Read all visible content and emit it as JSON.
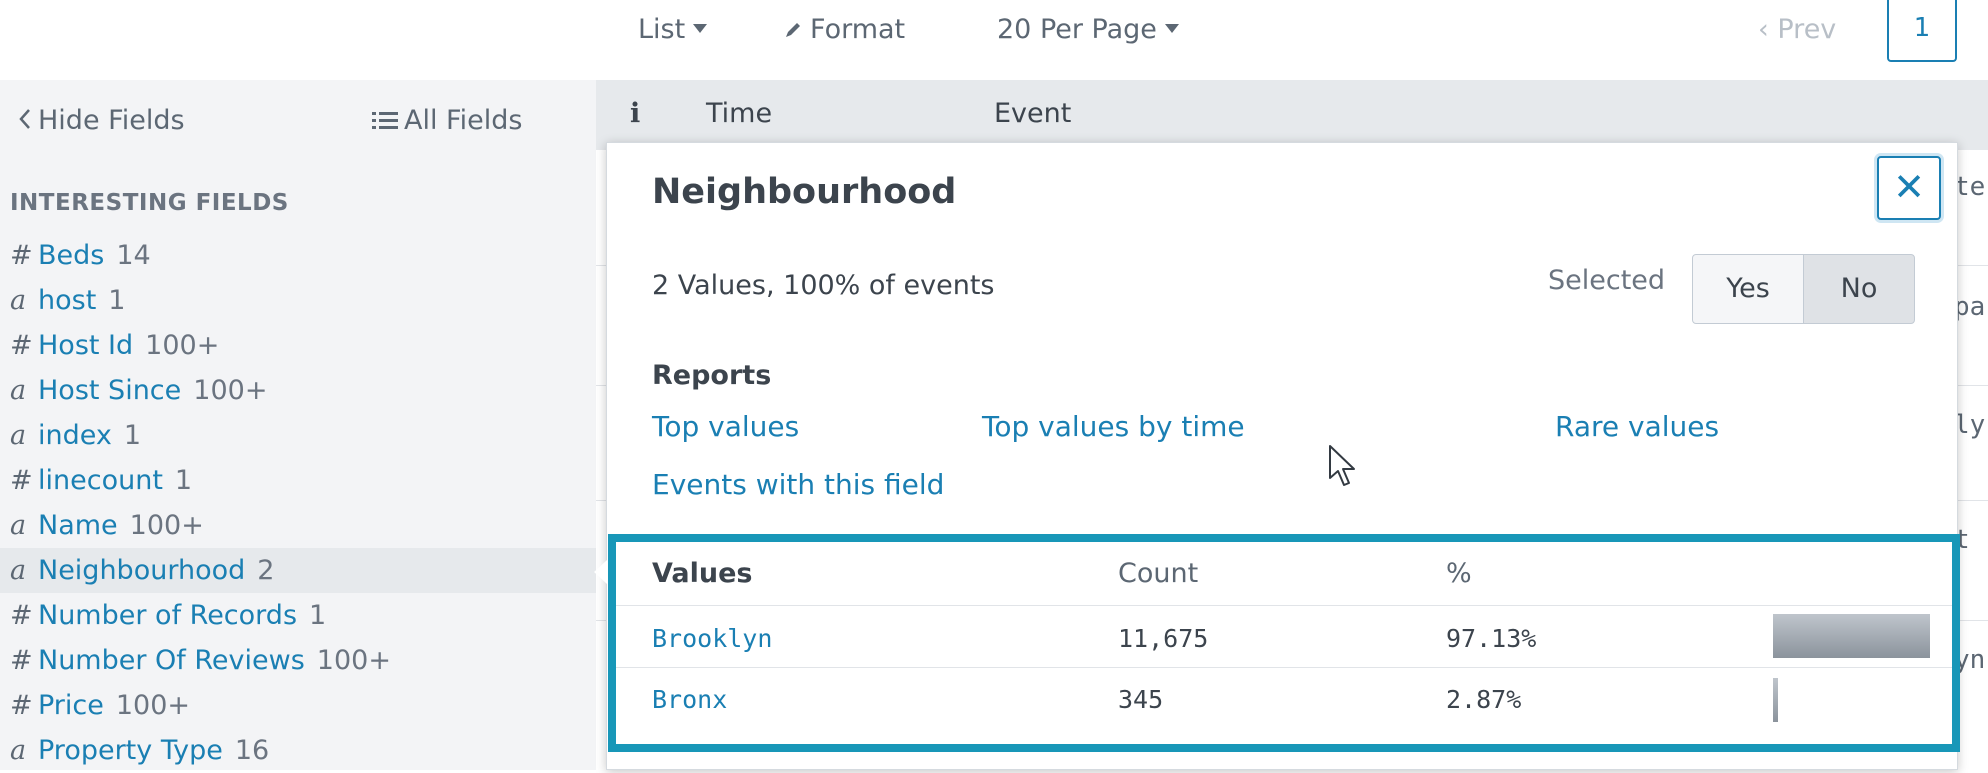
{
  "toolbar": {
    "list_label": "List",
    "format_label": "Format",
    "per_page_label": "20 Per Page",
    "prev_label": "‹ Prev",
    "page_number": "1"
  },
  "sidebar": {
    "hide_fields_label": "Hide Fields",
    "all_fields_label": "All Fields",
    "section_title": "INTERESTING FIELDS",
    "fields": [
      {
        "type": "#",
        "name": "Beds",
        "count": "14"
      },
      {
        "type": "a",
        "name": "host",
        "count": "1"
      },
      {
        "type": "#",
        "name": "Host Id",
        "count": "100+"
      },
      {
        "type": "a",
        "name": "Host Since",
        "count": "100+"
      },
      {
        "type": "a",
        "name": "index",
        "count": "1"
      },
      {
        "type": "#",
        "name": "linecount",
        "count": "1"
      },
      {
        "type": "a",
        "name": "Name",
        "count": "100+"
      },
      {
        "type": "a",
        "name": "Neighbourhood",
        "count": "2"
      },
      {
        "type": "#",
        "name": "Number of Records",
        "count": "1"
      },
      {
        "type": "#",
        "name": "Number Of Reviews",
        "count": "100+"
      },
      {
        "type": "#",
        "name": "Price",
        "count": "100+"
      },
      {
        "type": "a",
        "name": "Property Type",
        "count": "16"
      }
    ]
  },
  "events_header": {
    "info": "i",
    "time": "Time",
    "event": "Event"
  },
  "background_fragments": [
    "te",
    "pa",
    "ly",
    "t",
    "yn"
  ],
  "popover": {
    "title": "Neighbourhood",
    "close_symbol": "✕",
    "summary": "2 Values, 100% of events",
    "selected_label": "Selected",
    "yes_label": "Yes",
    "no_label": "No",
    "reports_label": "Reports",
    "reports": {
      "top_values": "Top values",
      "top_values_by_time": "Top values by time",
      "rare_values": "Rare values",
      "events_with_field": "Events with this field"
    },
    "table": {
      "headers": {
        "values": "Values",
        "count": "Count",
        "percent": "%"
      },
      "rows": [
        {
          "value": "Brooklyn",
          "count": "11,675",
          "percent": "97.13%",
          "fraction": 0.9713
        },
        {
          "value": "Bronx",
          "count": "345",
          "percent": "2.87%",
          "fraction": 0.0287
        }
      ]
    }
  },
  "colors": {
    "link": "#1a7fb3",
    "highlight": "#1897b8"
  }
}
